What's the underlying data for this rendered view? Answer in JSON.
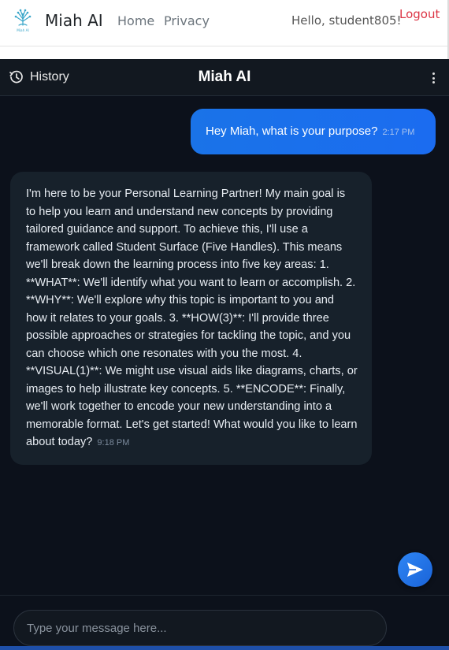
{
  "navbar": {
    "brand_name": "Miah AI",
    "logo_text": "Miah AI",
    "links": [
      "Home",
      "Privacy"
    ],
    "greeting": "Hello, student805!",
    "logout_label": "Logout"
  },
  "chat": {
    "history_label": "History",
    "title": "Miah AI",
    "messages": [
      {
        "role": "user",
        "text": "Hey Miah, what is your purpose?",
        "time": "2:17 PM"
      },
      {
        "role": "assistant",
        "text": "I'm here to be your Personal Learning Partner! My main goal is to help you learn and understand new concepts by providing tailored guidance and support. To achieve this, I'll use a framework called Student Surface (Five Handles). This means we'll break down the learning process into five key areas: 1. **WHAT**: We'll identify what you want to learn or accomplish. 2. **WHY**: We'll explore why this topic is important to you and how it relates to your goals. 3. **HOW(3)**: I'll provide three possible approaches or strategies for tackling the topic, and you can choose which one resonates with you the most. 4. **VISUAL(1)**: We might use visual aids like diagrams, charts, or images to help illustrate key concepts. 5. **ENCODE**: Finally, we'll work together to encode your new understanding into a memorable format. Let's get started! What would you like to learn about today?",
        "time": "9:18 PM"
      }
    ],
    "input_placeholder": "Type your message here..."
  },
  "icons": {
    "logo": "tree-logo-icon",
    "history": "clock-history-icon",
    "menu": "vertical-dots-icon",
    "send": "paper-plane-icon"
  },
  "colors": {
    "accent": "#1a73e8",
    "logout": "#dc3545",
    "chat_bg": "#0c111b",
    "bubble_bot": "#17212b"
  }
}
